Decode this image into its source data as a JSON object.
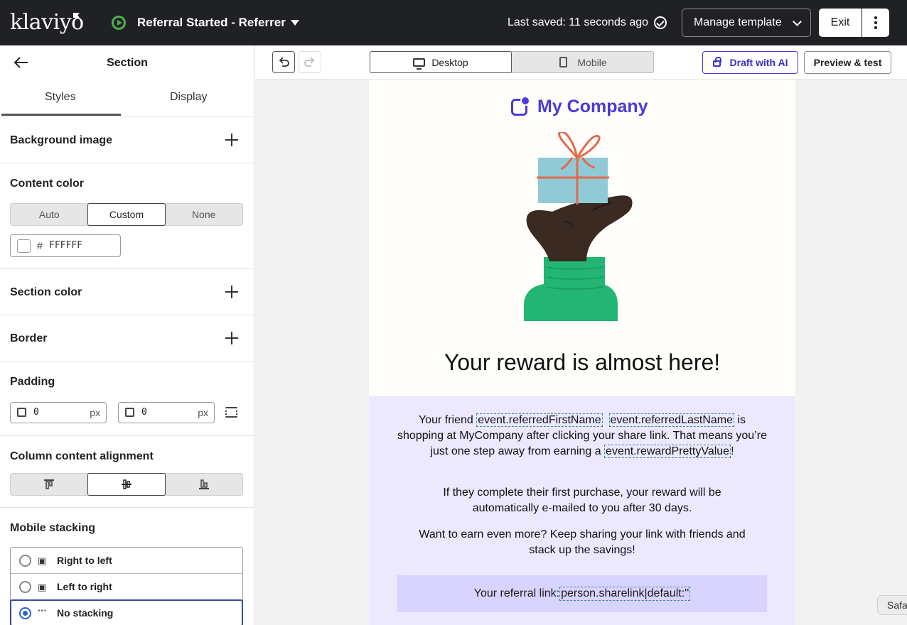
{
  "topbar": {
    "logo": "klaviyo",
    "flow_title": "Referral Started - Referrer",
    "last_saved": "Last saved: 11 seconds ago",
    "manage_label": "Manage template",
    "exit_label": "Exit"
  },
  "panel": {
    "title": "Section",
    "tabs": [
      "Styles",
      "Display"
    ],
    "background_image": "Background image",
    "content_color": {
      "heading": "Content color",
      "options": [
        "Auto",
        "Custom",
        "None"
      ],
      "selected": "Custom",
      "hash": "#",
      "hex": "FFFFFF"
    },
    "section_color": "Section color",
    "border": "Border",
    "padding": {
      "heading": "Padding",
      "vertical": "0",
      "horizontal": "0",
      "unit": "px"
    },
    "alignment": {
      "heading": "Column content alignment",
      "options": [
        "top",
        "middle",
        "bottom"
      ],
      "selected": "middle"
    },
    "mobile_stacking": {
      "heading": "Mobile stacking",
      "options": [
        "Right to left",
        "Left to right",
        "No stacking"
      ],
      "selected": "No stacking"
    }
  },
  "toolbar": {
    "desktop_label": "Desktop",
    "mobile_label": "Mobile",
    "draft_ai_label": "Draft with AI",
    "preview_label": "Preview & test"
  },
  "email": {
    "brand": "My Company",
    "headline": "Your reward is almost here!",
    "p1_a": "Your friend ",
    "p1_tag1": "event.referredFirstName",
    "p1_tag2": "event.referredLastName",
    "p1_b": " is shopping at MyCompany after clicking your share link. That means you’re just one step away from earning a ",
    "p1_tag3": "event.rewardPrettyValue",
    "p1_c": "!",
    "p2": "If they complete their first purchase, your reward will be automatically e-mailed to you after 30 days.",
    "p3": "Want to earn even more? Keep sharing your link with friends and stack up the savings!",
    "ref_label": "Your referral link: ",
    "ref_tag": "person.sharelink|default:''"
  },
  "safari_tab": "Safa",
  "colors": {
    "accent": "#4b3bd6",
    "topbar_bg": "#202124",
    "body_band": "#ebe8ff",
    "ref_band": "#d9d3ff"
  }
}
